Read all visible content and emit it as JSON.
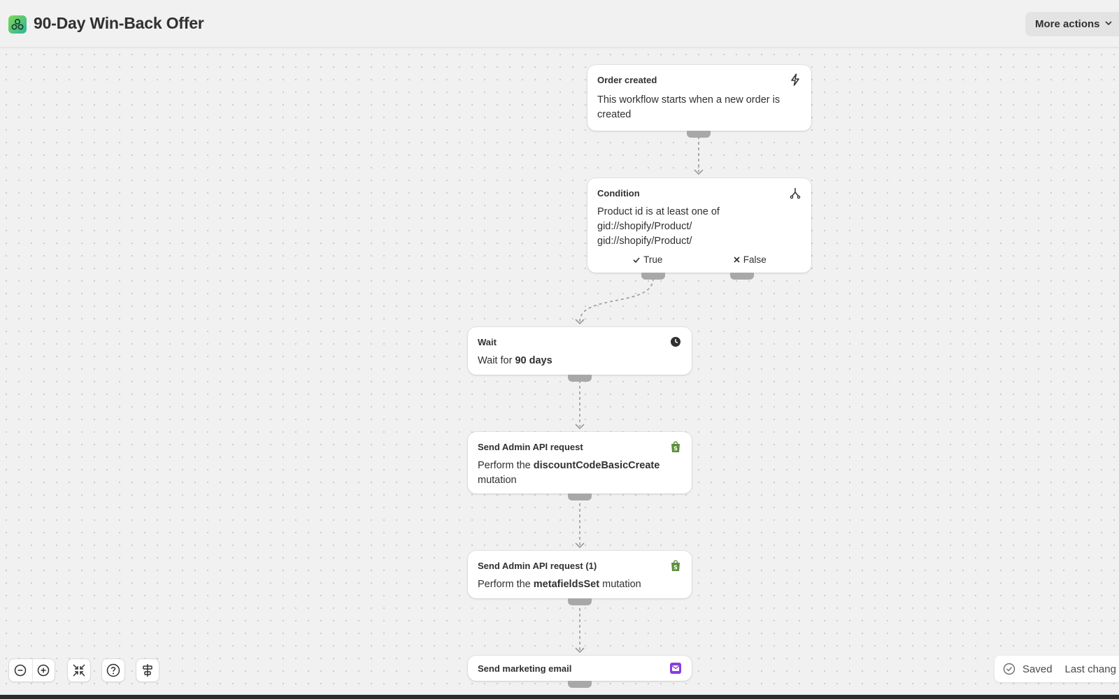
{
  "header": {
    "app_icon": "flow-icon",
    "title": "90-Day Win-Back Offer",
    "more_actions_label": "More actions"
  },
  "nodes": {
    "trigger": {
      "title": "Order created",
      "icon": "lightning-icon",
      "description": "This workflow starts when a new order is created"
    },
    "condition": {
      "title": "Condition",
      "icon": "branch-icon",
      "line1": "Product id is at least one of",
      "line2": "gid://shopify/Product/",
      "line3": "gid://shopify/Product/",
      "true_label": "True",
      "false_label": "False"
    },
    "wait": {
      "title": "Wait",
      "icon": "clock-icon",
      "prefix": "Wait for",
      "duration": "90 days"
    },
    "api1": {
      "title": "Send Admin API request",
      "icon": "shopify-bag-icon",
      "prefix": "Perform the",
      "mutation": "discountCodeBasicCreate",
      "suffix": "mutation"
    },
    "api2": {
      "title": "Send Admin API request (1)",
      "icon": "shopify-bag-icon",
      "prefix": "Perform the",
      "mutation": "metafieldsSet",
      "suffix": "mutation"
    },
    "email": {
      "title": "Send marketing email",
      "icon": "marketing-email-icon"
    }
  },
  "toolbar": {
    "zoom_out": "zoom-out-icon",
    "zoom_in": "zoom-in-icon",
    "fit": "fit-view-icon",
    "help": "help-icon",
    "align": "auto-layout-icon"
  },
  "status": {
    "saved_label": "Saved",
    "last_changed": "Last chang"
  },
  "colors": {
    "canvas": "#f1f1f1",
    "shopify_green": "#5e8e3e",
    "connector": "#9a9a9a"
  }
}
